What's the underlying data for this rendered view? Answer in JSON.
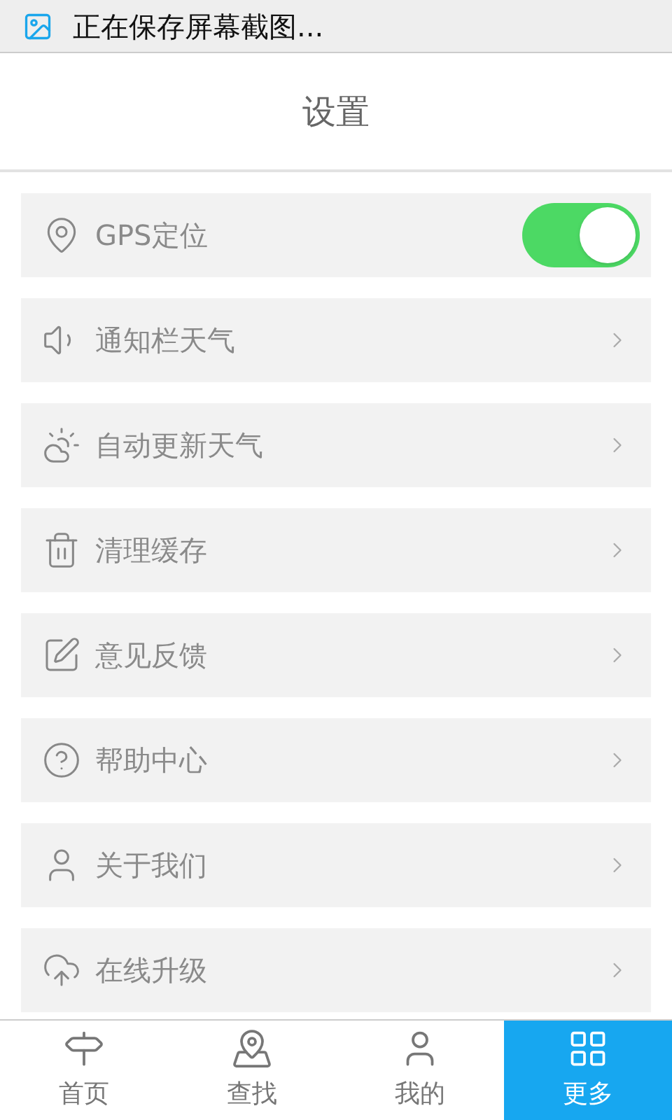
{
  "status_bar": {
    "notification": "正在保存屏幕截图..."
  },
  "header": {
    "title": "设置"
  },
  "settings": [
    {
      "kind": "toggle",
      "label": "GPS定位",
      "on": true
    },
    {
      "kind": "link",
      "label": "通知栏天气"
    },
    {
      "kind": "link",
      "label": "自动更新天气"
    },
    {
      "kind": "link",
      "label": "清理缓存"
    },
    {
      "kind": "link",
      "label": "意见反馈"
    },
    {
      "kind": "link",
      "label": "帮助中心"
    },
    {
      "kind": "link",
      "label": "关于我们"
    },
    {
      "kind": "link",
      "label": "在线升级"
    }
  ],
  "tab_bar": [
    {
      "label": "首页",
      "selected": false
    },
    {
      "label": "查找",
      "selected": false
    },
    {
      "label": "我的",
      "selected": false
    },
    {
      "label": "更多",
      "selected": true
    }
  ]
}
